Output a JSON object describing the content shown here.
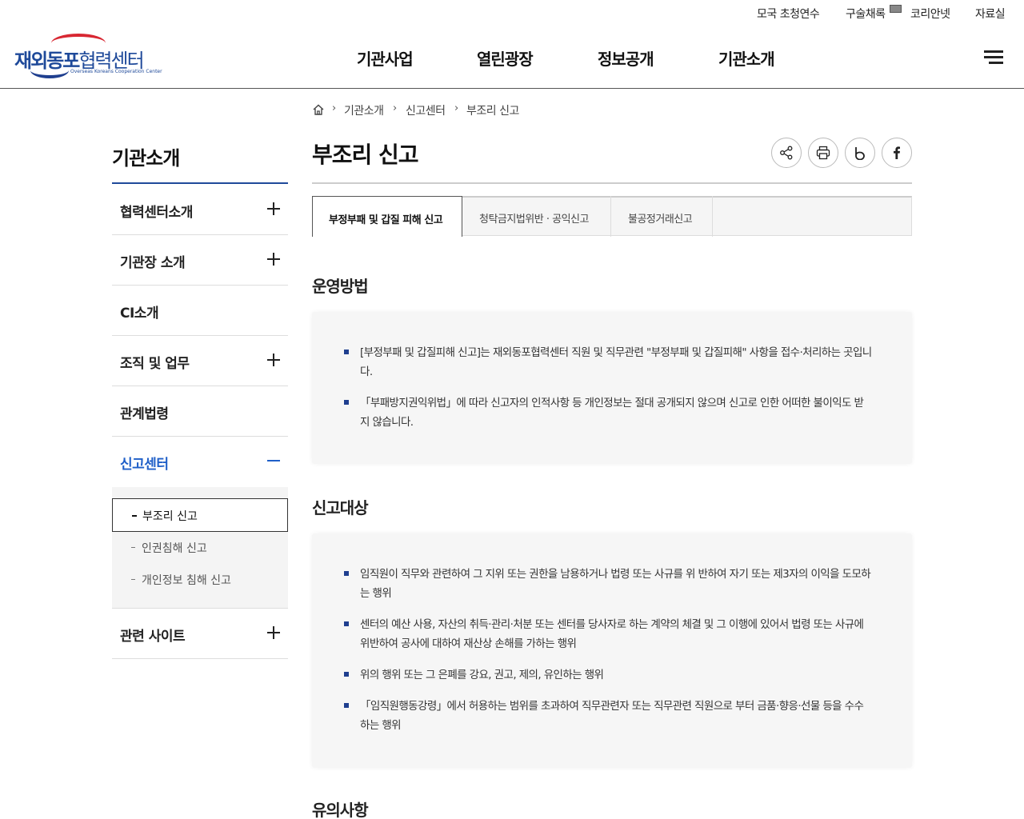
{
  "util_links": [
    "모국 초청연수",
    "구술채록",
    "코리안넷",
    "자료실"
  ],
  "logo": {
    "main": "재외동포",
    "sub_main": "협력센터",
    "sub": "Overseas Koreans Cooperation Center"
  },
  "gnb": [
    "기관사업",
    "열린광장",
    "정보공개",
    "기관소개"
  ],
  "breadcrumb": [
    "기관소개",
    "신고센터",
    "부조리 신고"
  ],
  "sidebar": {
    "title": "기관소개",
    "items": [
      {
        "label": "협력센터소개"
      },
      {
        "label": "기관장 소개"
      },
      {
        "label": "CI소개"
      },
      {
        "label": "조직 및 업무"
      },
      {
        "label": "관계법령"
      },
      {
        "label": "신고센터"
      },
      {
        "label": "관련 사이트"
      }
    ],
    "sub_items": [
      "부조리 신고",
      "인권침해 신고",
      "개인정보 침해 신고"
    ]
  },
  "page_title": "부조리 신고",
  "tool_icons": [
    "share-icon",
    "print-icon",
    "blog-icon",
    "facebook-icon"
  ],
  "tabs": [
    "부정부패 및 갑질 피해 신고",
    "청탁금지법위반 · 공익신고",
    "불공정거래신고"
  ],
  "sections": [
    {
      "title": "운영방법",
      "bullets": [
        "[부정부패 및 갑질피해 신고]는 재외동포협력센터 직원 및 직무관련 \"부정부패 및 갑질피해\" 사항을 접수·처리하는 곳입니다.",
        "「부패방지권익위법」에 따라 신고자의 인적사항 등 개인정보는 절대 공개되지 않으며 신고로 인한 어떠한 불이익도 받지 않습니다."
      ]
    },
    {
      "title": "신고대상",
      "bullets": [
        "임직원이 직무와 관련하여 그 지위 또는 권한을 남용하거나 법령 또는 사규를 위 반하여 자기 또는 제3자의 이익을 도모하는 행위",
        "센터의 예산 사용, 자산의 취득·관리·처분 또는 센터를 당사자로 하는 계약의 체결 및 그 이행에 있어서 법령 또는 사규에 위반하여 공사에 대하여 재산상 손해를 가하는 행위",
        "위의 행위 또는 그 은폐를 강요, 권고, 제의, 유인하는 행위",
        "「임직원행동강령」에서 허용하는 범위를 초과하여 직무관련자 또는 직무관련 직원으로 부터 금품·향응·선물 등을 수수하는 행위"
      ]
    },
    {
      "title": "유의사항"
    }
  ]
}
